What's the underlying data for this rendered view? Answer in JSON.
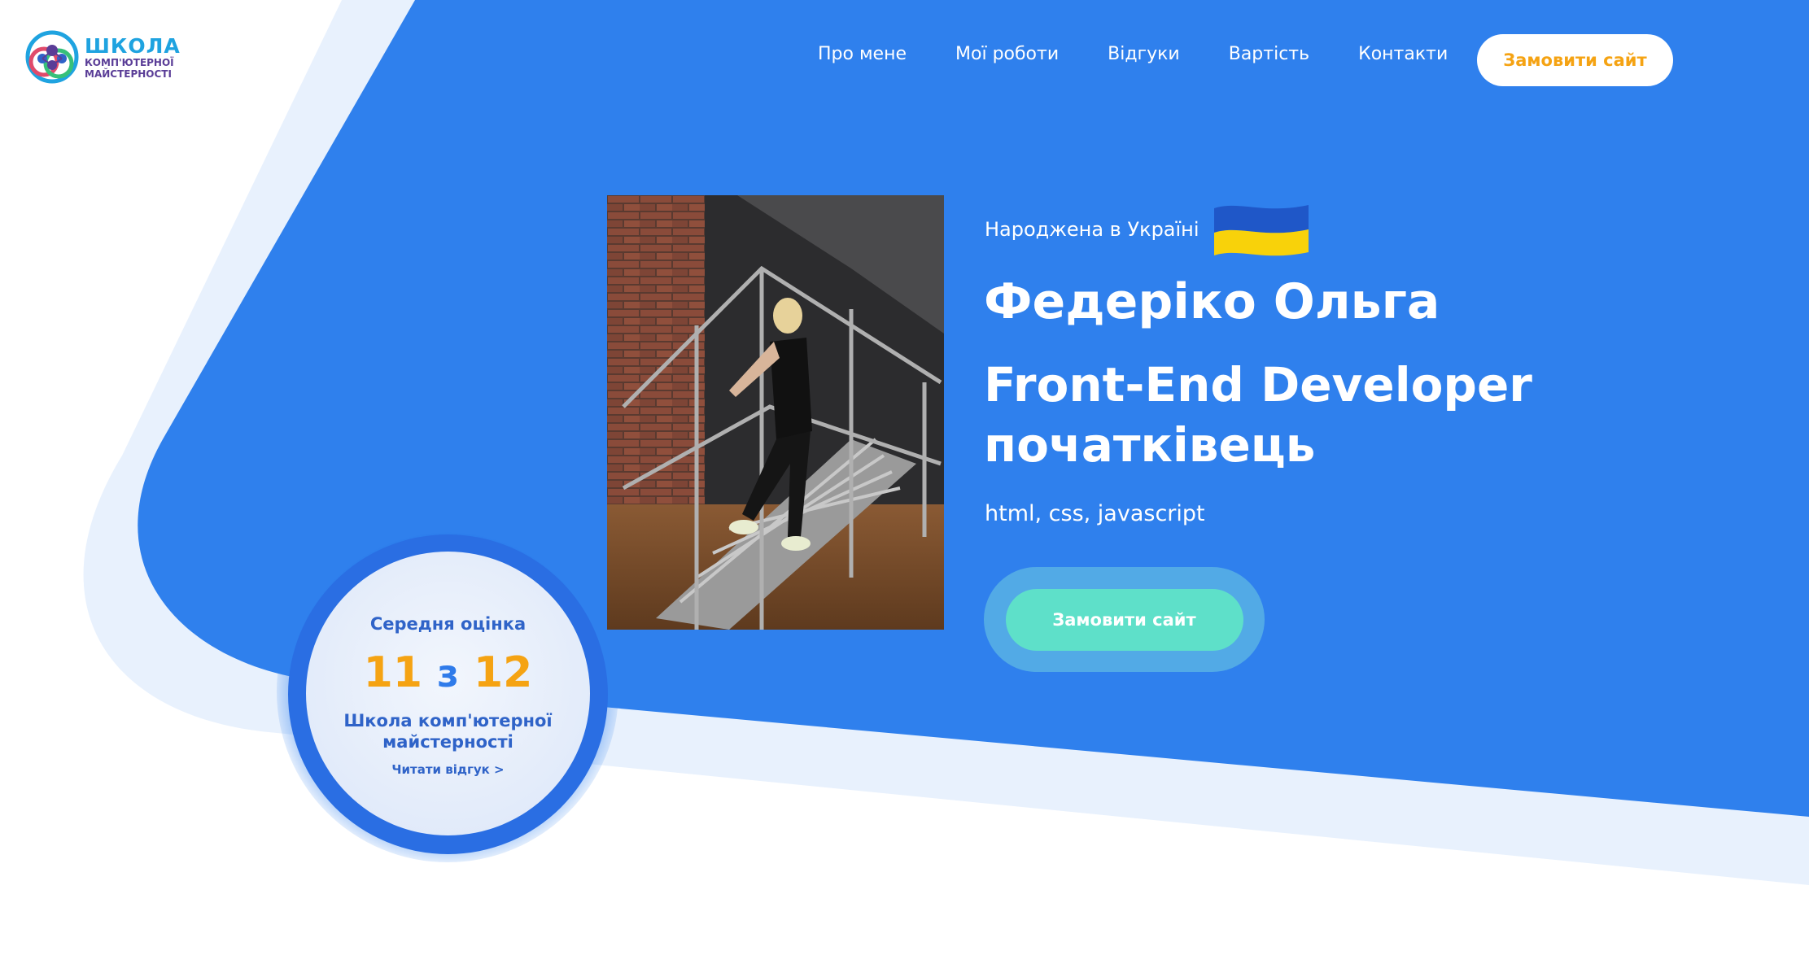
{
  "header": {
    "logo": {
      "title": "ШКОЛА",
      "subtitle_line1": "КОМП'ЮТЕРНОЇ",
      "subtitle_line2": "МАЙСТЕРНОСТІ",
      "icon": "school-logo-icon"
    },
    "nav": [
      {
        "label": "Про мене"
      },
      {
        "label": "Мої роботи"
      },
      {
        "label": "Відгуки"
      },
      {
        "label": "Вартість"
      },
      {
        "label": "Контакти"
      }
    ],
    "cta_label": "Замовити сайт"
  },
  "hero": {
    "born_text": "Народжена в Україні",
    "flag_icon": "ukraine-flag-icon",
    "name": "Федеріко Ольга",
    "role_line1": "Front-End Developer",
    "role_line2": "початківець",
    "skills": "html, css, javascript",
    "cta_label": "Замовити сайт"
  },
  "rating": {
    "title": "Середня оцінка",
    "score": "11",
    "separator": "з",
    "max": "12",
    "school": "Школа комп'ютерної майстерності",
    "link_label": "Читати відгук >"
  },
  "colors": {
    "primary_blue": "#2f80ed",
    "light_blue": "#e8f1fd",
    "accent_orange": "#f5a313",
    "accent_teal": "#5ee0c9",
    "text_white": "#ffffff"
  }
}
